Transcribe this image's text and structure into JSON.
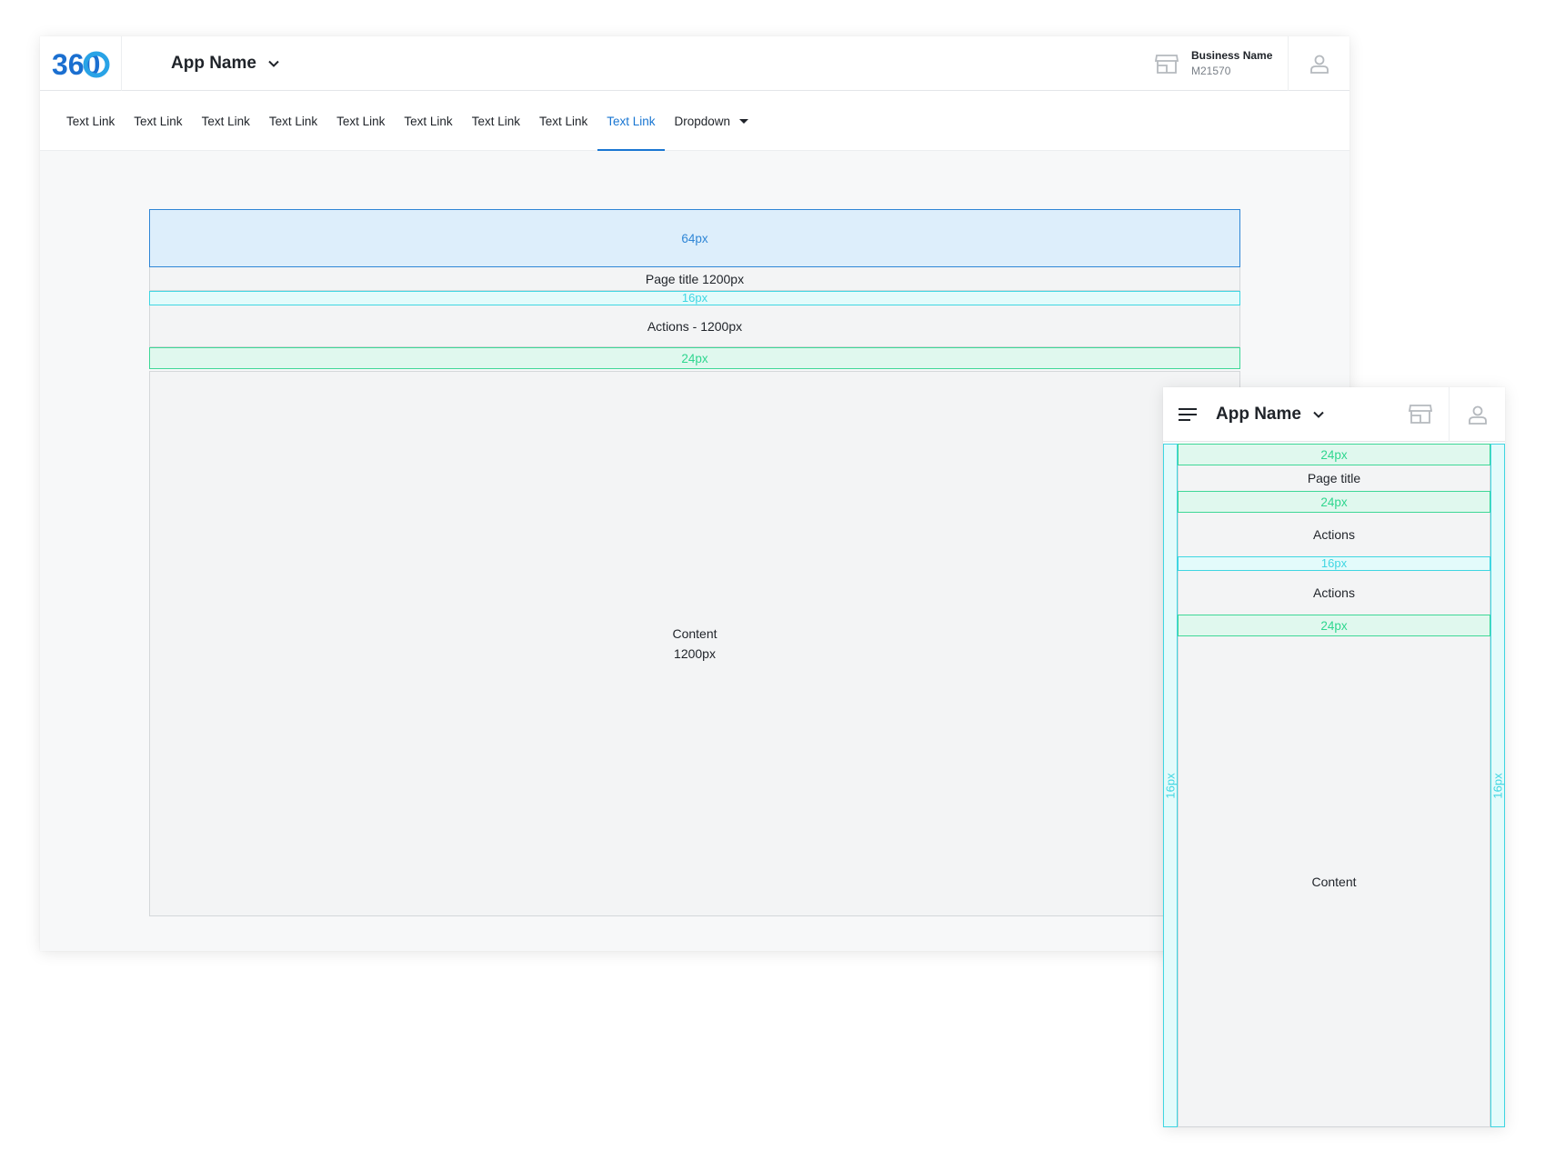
{
  "desktop": {
    "logo_text": "360",
    "app_name": "App Name",
    "business": {
      "name": "Business Name",
      "id": "M21570"
    },
    "nav": {
      "links": [
        "Text Link",
        "Text Link",
        "Text Link",
        "Text Link",
        "Text Link",
        "Text Link",
        "Text Link",
        "Text Link",
        "Text Link"
      ],
      "active_index": 8,
      "dropdown_label": "Dropdown"
    },
    "spec": {
      "header_spacing": "64px",
      "page_title": "Page title 1200px",
      "title_gap": "16px",
      "actions": "Actions - 1200px",
      "actions_gap": "24px",
      "content_line1": "Content",
      "content_line2": "1200px"
    }
  },
  "mobile": {
    "app_name": "App Name",
    "spec": {
      "top_gap": "24px",
      "page_title": "Page title",
      "title_gap": "24px",
      "actions_1": "Actions",
      "actions_gap": "16px",
      "actions_2": "Actions",
      "content_gap": "24px",
      "content": "Content",
      "side_padding": "16px"
    }
  },
  "colors": {
    "accent": "#1976d2",
    "spacing_blue": "#2f86d6",
    "spacing_cyan": "#3fd6e2",
    "spacing_green": "#2fd68f"
  }
}
